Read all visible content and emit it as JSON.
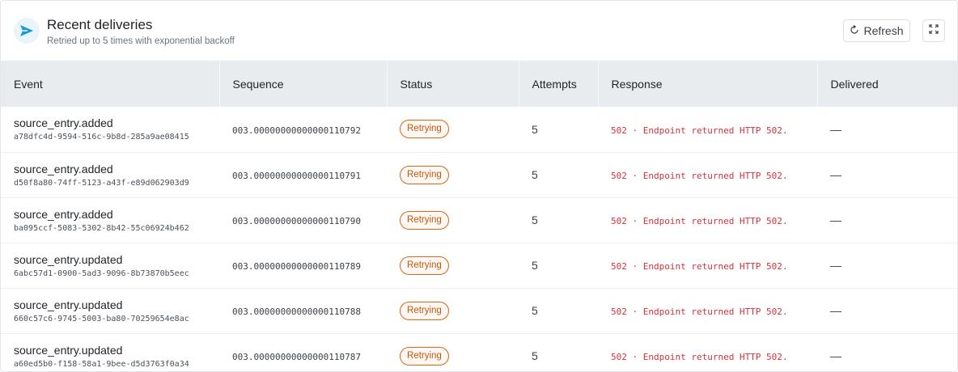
{
  "header": {
    "title": "Recent deliveries",
    "subtitle": "Retried up to 5 times with exponential backoff",
    "refresh_label": "Refresh",
    "accent_color": "#1a9ad6",
    "icon": "send-icon"
  },
  "table": {
    "columns": [
      "Event",
      "Sequence",
      "Status",
      "Attempts",
      "Response",
      "Delivered"
    ],
    "rows": [
      {
        "event": "source_entry.added",
        "id": "a78dfc4d-9594-516c-9b8d-285a9ae08415",
        "sequence": "003.00000000000000110792",
        "status": "Retrying",
        "attempts": "5",
        "response": "502 · Endpoint returned HTTP 502.",
        "delivered": "—"
      },
      {
        "event": "source_entry.added",
        "id": "d50f8a80-74ff-5123-a43f-e89d062903d9",
        "sequence": "003.00000000000000110791",
        "status": "Retrying",
        "attempts": "5",
        "response": "502 · Endpoint returned HTTP 502.",
        "delivered": "—"
      },
      {
        "event": "source_entry.added",
        "id": "ba095ccf-5083-5302-8b42-55c06924b462",
        "sequence": "003.00000000000000110790",
        "status": "Retrying",
        "attempts": "5",
        "response": "502 · Endpoint returned HTTP 502.",
        "delivered": "—"
      },
      {
        "event": "source_entry.updated",
        "id": "6abc57d1-0900-5ad3-9096-8b73870b5eec",
        "sequence": "003.00000000000000110789",
        "status": "Retrying",
        "attempts": "5",
        "response": "502 · Endpoint returned HTTP 502.",
        "delivered": "—"
      },
      {
        "event": "source_entry.updated",
        "id": "660c57c6-9745-5003-ba80-70259654e8ac",
        "sequence": "003.00000000000000110788",
        "status": "Retrying",
        "attempts": "5",
        "response": "502 · Endpoint returned HTTP 502.",
        "delivered": "—"
      },
      {
        "event": "source_entry.updated",
        "id": "a60ed5b0-f158-58a1-9bee-d5d3763f0a34",
        "sequence": "003.00000000000000110787",
        "status": "Retrying",
        "attempts": "5",
        "response": "502 · Endpoint returned HTTP 502.",
        "delivered": "—"
      }
    ]
  }
}
